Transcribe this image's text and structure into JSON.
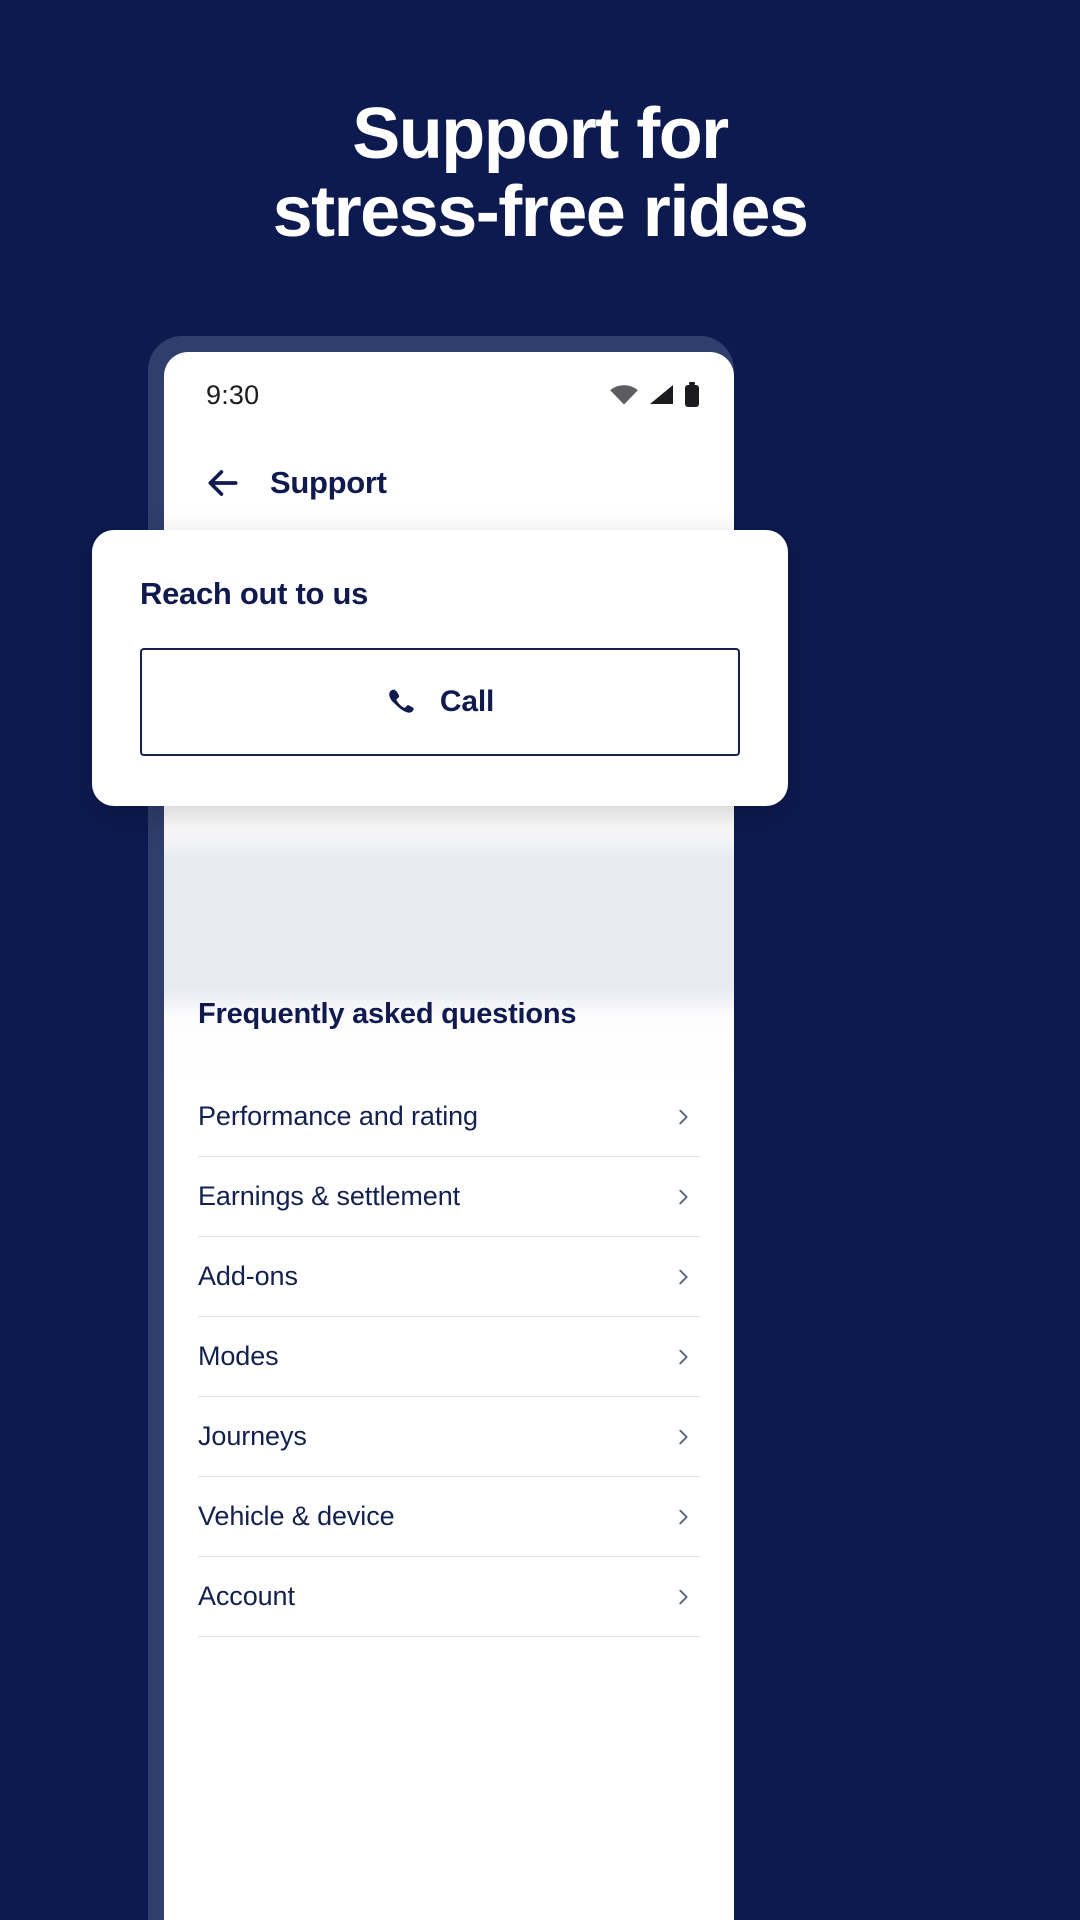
{
  "theme": {
    "background": "#0d1a4f",
    "navy": "#101a4e",
    "frame": "#303e6e",
    "divider": "#e3e5ec",
    "white": "#ffffff"
  },
  "headline": {
    "line1": "Support for",
    "line2": "stress-free rides"
  },
  "phone": {
    "status_bar": {
      "time": "9:30",
      "icons": [
        "wifi-icon",
        "signal-icon",
        "battery-icon"
      ]
    },
    "app_bar": {
      "back_icon": "back-arrow-icon",
      "title": "Support"
    },
    "faq": {
      "title": "Frequently asked questions",
      "items": [
        {
          "label": "Performance and rating",
          "chevron": "chevron-right-icon"
        },
        {
          "label": "Earnings & settlement",
          "chevron": "chevron-right-icon"
        },
        {
          "label": "Add-ons",
          "chevron": "chevron-right-icon"
        },
        {
          "label": "Modes",
          "chevron": "chevron-right-icon"
        },
        {
          "label": "Journeys",
          "chevron": "chevron-right-icon"
        },
        {
          "label": "Vehicle & device",
          "chevron": "chevron-right-icon"
        },
        {
          "label": "Account",
          "chevron": "chevron-right-icon"
        }
      ]
    }
  },
  "overlay": {
    "title": "Reach out to us",
    "call_button": {
      "label": "Call",
      "icon": "phone-handset-icon"
    }
  }
}
